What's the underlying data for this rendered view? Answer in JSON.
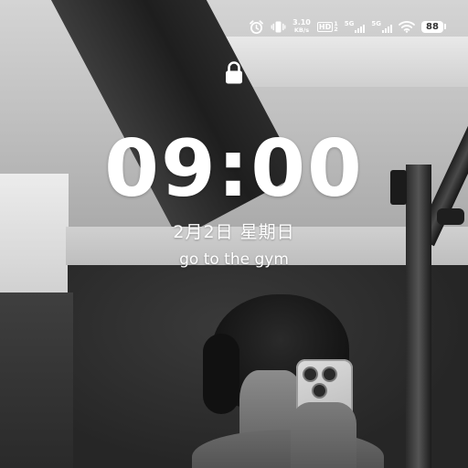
{
  "status_bar": {
    "icons": [
      "alarm-icon",
      "vibrate-icon",
      "hd-voice-icon",
      "signal-5g-sim1-icon",
      "signal-5g-sim2-icon",
      "wifi-icon",
      "battery-icon"
    ],
    "net_speed_value": "3.10",
    "net_speed_unit": "KB/s",
    "hd_label": "HD",
    "hd_sub": "1",
    "hd_sub2": "2",
    "sim1_label": "5G",
    "sim2_label": "5G",
    "battery_level": "88"
  },
  "lock_screen": {
    "lock_icon": "lock-icon",
    "time": "09:00",
    "date": "2月2日 星期日",
    "memo": "go to the gym"
  },
  "colors": {
    "text": "#ffffff"
  }
}
